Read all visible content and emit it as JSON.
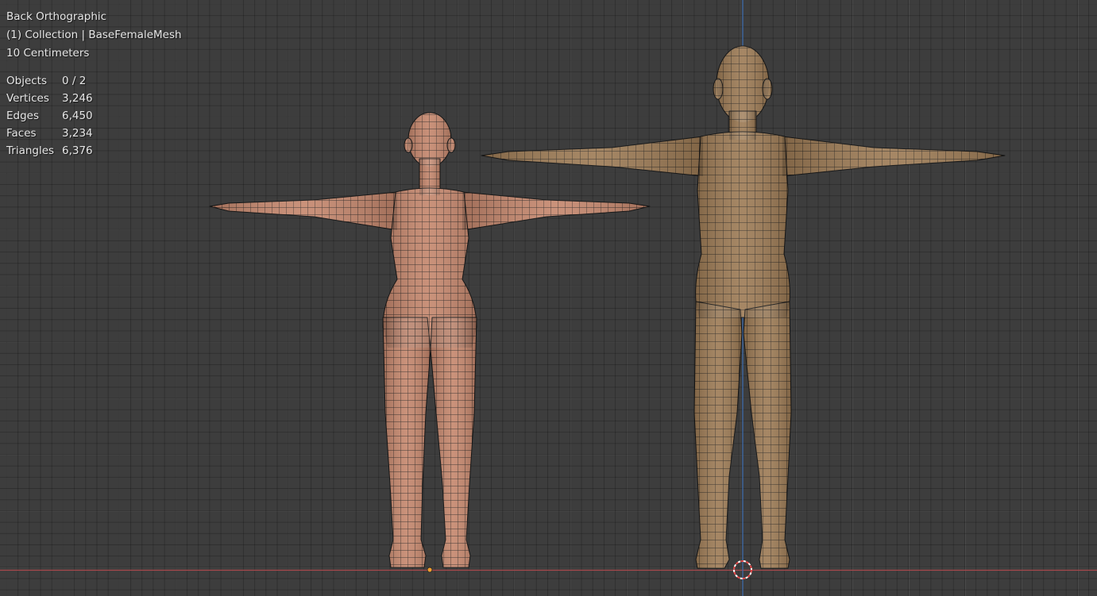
{
  "viewport": {
    "view_name": "Back Orthographic",
    "collection_info": "(1) Collection | BaseFemaleMesh",
    "grid_scale": "10 Centimeters"
  },
  "stats": [
    {
      "label": "Objects",
      "value": "0 / 2"
    },
    {
      "label": "Vertices",
      "value": "3,246"
    },
    {
      "label": "Edges",
      "value": "6,450"
    },
    {
      "label": "Faces",
      "value": "3,234"
    },
    {
      "label": "Triangles",
      "value": "6,376"
    }
  ],
  "colors": {
    "background": "#3d3d3d",
    "x_axis": "#a8484c",
    "z_axis": "#3e6eb0",
    "mesh_left": "#c4866c",
    "mesh_right": "#9c7a54",
    "wire": "#141414"
  }
}
